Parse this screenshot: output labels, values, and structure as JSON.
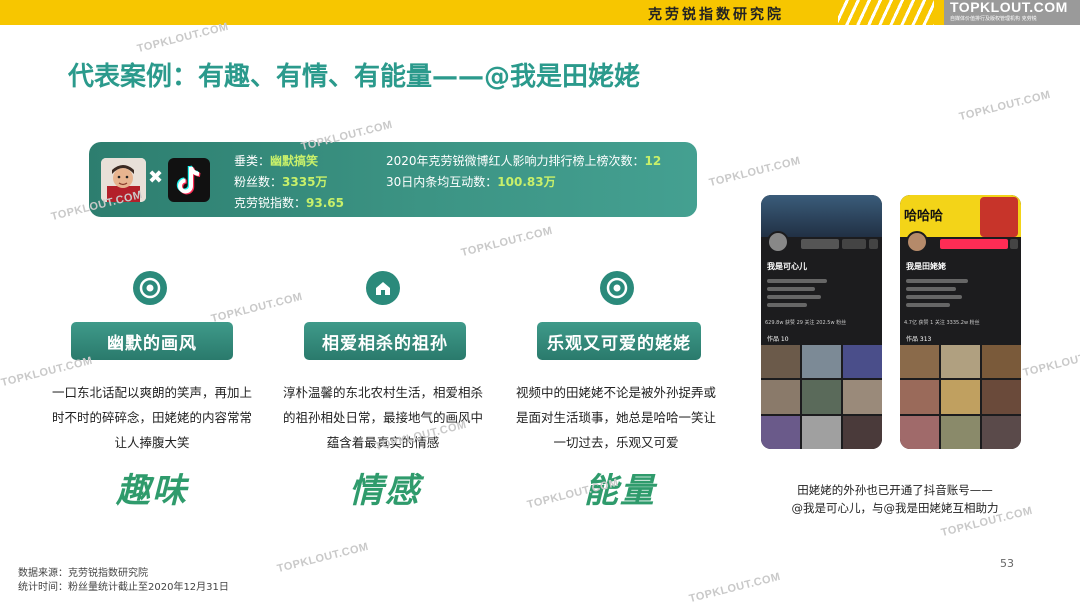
{
  "header": {
    "org_name": "克劳锐指数研究院",
    "logo_text": "TOPKLOUT.COM",
    "logo_sub": "自媒体价值排行及版权管理机构 克劳锐"
  },
  "title": "代表案例：有趣、有情、有能量——@我是田姥姥",
  "banner": {
    "category_label": "垂类：",
    "category_value": "幽默搞笑",
    "fans_label": "粉丝数：",
    "fans_value": "3335万",
    "index_label": "克劳锐指数：",
    "index_value": "93.65",
    "rank_label": "2020年克劳锐微博红人影响力排行榜上榜次数：",
    "rank_value": "12",
    "interaction_label": "30日内条均互动数：",
    "interaction_value": "100.83万",
    "times_symbol": "✖"
  },
  "features": [
    {
      "icon": "target-icon",
      "pill": "幽默的画风",
      "desc": "一口东北话配以爽朗的笑声，再加上时不时的碎碎念，田姥姥的内容常常让人捧腹大笑",
      "keyword": "趣味"
    },
    {
      "icon": "house-icon",
      "pill": "相爱相杀的祖孙",
      "desc": "淳朴温馨的东北农村生活，相爱相杀的祖孙相处日常，最接地气的画风中蕴含着最真实的情感",
      "keyword": "情感"
    },
    {
      "icon": "target-icon",
      "pill": "乐观又可爱的姥姥",
      "desc": "视频中的田姥姥不论是被外孙捉弄或是面对生活琐事，她总是哈哈一笑让一切过去，乐观又可爱",
      "keyword": "能量"
    }
  ],
  "phones": {
    "left_name": "我是可心儿",
    "right_name": "我是田姥姥",
    "right_banner": "哈哈哈",
    "left_stats": "629.8w 获赞  29 关注  202.5w 粉丝",
    "right_stats": "4.7亿 获赞  1 关注  3335.2w 粉丝",
    "left_tab": "作品 10",
    "right_tab": "作品 313"
  },
  "caption": {
    "line1": "田姥姥的外孙也已开通了抖音账号——",
    "line2": "@我是可心儿，与@我是田姥姥互相助力"
  },
  "footer": {
    "source": "数据来源：克劳锐指数研究院",
    "stat_time": "统计时间：粉丝量统计截止至2020年12月31日"
  },
  "page_number": "53",
  "watermark": "TOPKLOUT.COM",
  "colors": {
    "topbar": "#f7c600",
    "title": "#2b9a8c",
    "banner": "#2d7e6f",
    "accent_value": "#c8f06a",
    "keyword": "#2f9b6c"
  }
}
